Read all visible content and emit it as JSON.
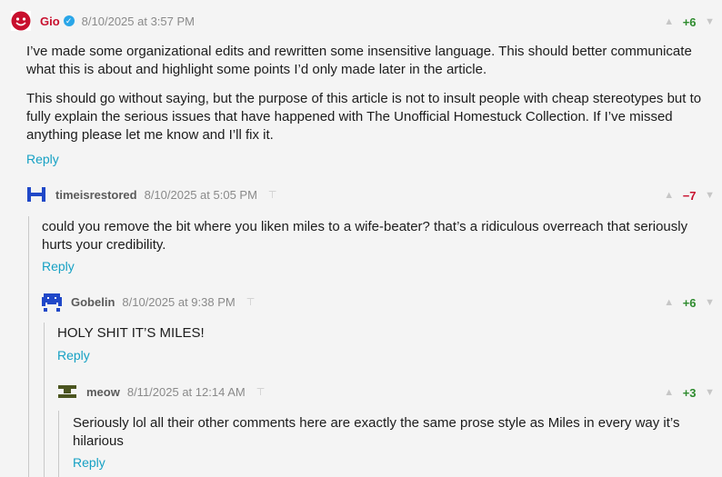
{
  "colors": {
    "accent": "#16a1c4",
    "positive": "#2e8b2e",
    "negative": "#c8102e",
    "verified": "#2aa6e8"
  },
  "comments": [
    {
      "author": "Gio",
      "verified": true,
      "timestamp": "8/10/2025 at 3:57 PM",
      "score": "+6",
      "paragraphs": [
        "I’ve made some organizational edits and rewritten some insensitive language. This should better communicate what this is about and highlight some points I’d only made later in the article.",
        "This should go without saying, but the purpose of this article is not to insult people with cheap stereotypes but to fully explain the serious issues that have happened with The Unofficial Homestuck Collection. If I’ve missed anything please let me know and I’ll fix it."
      ],
      "reply_label": "Reply",
      "avatar_icon": "red-troll-face-icon"
    },
    {
      "author": "timeisrestored",
      "timestamp": "8/10/2025 at 5:05 PM",
      "score": "−7",
      "paragraphs": [
        "could you remove the bit where you liken miles to a wife-beater? that’s a ridiculous overreach that seriously hurts your credibility."
      ],
      "reply_label": "Reply",
      "avatar_icon": "blue-h-symbol-icon"
    },
    {
      "author": "Gobelin",
      "timestamp": "8/10/2025 at 9:38 PM",
      "score": "+6",
      "paragraphs": [
        "HOLY SHIT IT’S MILES!"
      ],
      "reply_label": "Reply",
      "avatar_icon": "blue-pixel-space-invader-icon"
    },
    {
      "author": "meow",
      "timestamp": "8/11/2025 at 12:14 AM",
      "score": "+3",
      "paragraphs": [
        "Seriously lol all their other comments here are exactly the same prose style as Miles in every way it’s hilarious"
      ],
      "reply_label": "Reply",
      "avatar_icon": "olive-pixel-bars-icon"
    }
  ]
}
